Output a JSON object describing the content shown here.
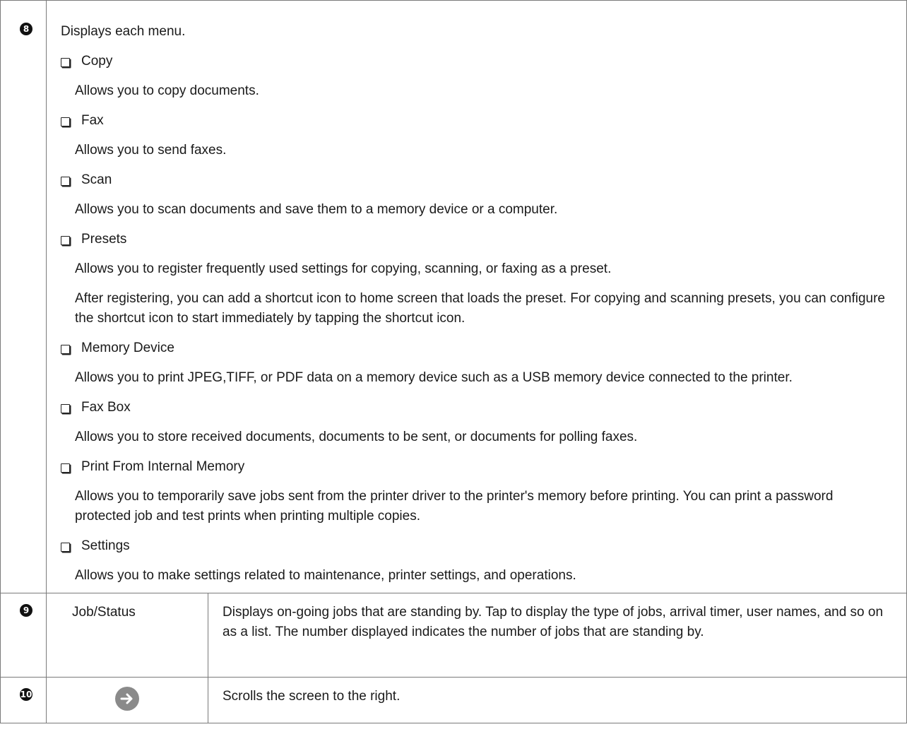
{
  "row8": {
    "badge": "8",
    "lead": "Displays each menu.",
    "items": [
      {
        "label": "Copy",
        "desc": [
          "Allows you to copy documents."
        ]
      },
      {
        "label": "Fax",
        "desc": [
          "Allows you to send faxes."
        ]
      },
      {
        "label": "Scan",
        "desc": [
          "Allows you to scan documents and save them to a memory device or a computer."
        ]
      },
      {
        "label": "Presets",
        "desc": [
          "Allows you to register frequently used settings for copying, scanning, or faxing as a preset.",
          "After registering, you can add a shortcut icon to home screen that loads the preset. For copying and scanning presets, you can configure the shortcut icon to start immediately by tapping the shortcut icon."
        ]
      },
      {
        "label": "Memory Device",
        "desc": [
          "Allows you to print JPEG,TIFF, or PDF data on a memory device such as a USB memory device connected to the printer."
        ]
      },
      {
        "label": "Fax Box",
        "desc": [
          "Allows you to store received documents, documents to be sent, or documents for polling faxes."
        ]
      },
      {
        "label": "Print From Internal Memory",
        "desc": [
          "Allows you to temporarily save jobs sent from the printer driver to the printer's memory before printing. You can print a password protected job and test prints when printing multiple copies."
        ]
      },
      {
        "label": "Settings",
        "desc": [
          "Allows you to make settings related to maintenance, printer settings, and operations."
        ]
      }
    ]
  },
  "row9": {
    "badge": "9",
    "name": "Job/Status",
    "desc": "Displays on-going jobs that are standing by. Tap to display the type of jobs, arrival timer, user names, and so on as a list. The number displayed indicates the number of jobs that are standing by."
  },
  "row10": {
    "badge": "10",
    "icon": "arrow-right-icon",
    "desc": "Scrolls the screen to the right."
  }
}
